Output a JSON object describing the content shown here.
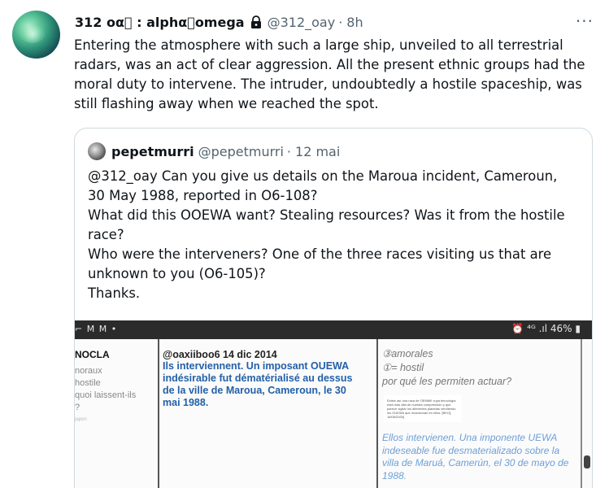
{
  "tweet": {
    "display_name": "312 ᴏα⃝ : alphα⃝omega",
    "handle": "@312_oay",
    "dot": "·",
    "time": "8h",
    "more": "···",
    "text": "Entering the atmosphere with such a large ship, unveiled to all terrestrial radars, was an act of clear aggression. All the present ethnic groups had the moral duty to intervene. The intruder, undoubtedly a hostile spaceship, was still flashing away when we reached the spot.",
    "icons": {
      "lock": "lock-icon",
      "more": "more-icon"
    }
  },
  "quote": {
    "display_name": "pepetmurri",
    "handle": "@pepetmurri",
    "dot": "·",
    "time": "12 mai",
    "lines": [
      "@312_oay Can you give us details on the Maroua incident, Cameroun,",
      "30 May 1988, reported in O6-108?",
      "What did this OOEWA want? Stealing resources? Was it from the hostile",
      "race?",
      "Who were the interveners? One of the three races visiting us that are",
      "unknown to you (O6-105)?",
      "Thanks."
    ]
  },
  "screenshot": {
    "status_left": "⌐ M M •",
    "status_right": "⏰ ⁴ᴳ .ıl 46% ▮",
    "col1": {
      "heading": "NOCLA",
      "lines": [
        "noraux",
        "hostile",
        "quoi laissent-ils",
        "?"
      ],
      "tiny": "japon"
    },
    "col2": {
      "heading": "@oaxiiboo6 14 dic 2014",
      "body": "Ils interviennent. Un imposant OUEWA indésirable fut dématérialisé au dessus de la ville de Maroua, Cameroun, le 30 mai 1988."
    },
    "col3": {
      "line1": "③amorales",
      "line2": "①= hostil",
      "line3": "por qué les permiten actuar?",
      "small": "Existe así una raza de OEMMII cuya tecnología está más allá de nuestra comprensión y que parece vigilar los diferentes planetas vendiendo los OUEWA que incursionan en ellos. [BKO], 16/06/2003)",
      "blue": "Ellos intervienen. Una imponente UEWA indeseable fue desmaterializado sobre la villa de Maruá, Camerún, el 30 de mayo de 1988."
    }
  }
}
